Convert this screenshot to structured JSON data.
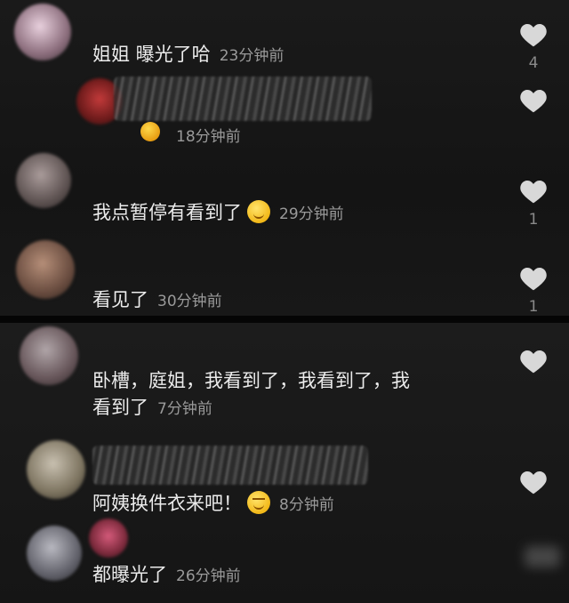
{
  "comments": [
    {
      "text": "姐姐 曝光了哈",
      "time": "23分钟前",
      "likes": "4"
    },
    {
      "reply_time": "18分钟前"
    },
    {
      "text": "我点暂停有看到了",
      "time": "29分钟前",
      "likes": "1"
    },
    {
      "text": "看见了",
      "time": "30分钟前",
      "likes": "1"
    },
    {
      "text_line1": "卧槽，庭姐，我看到了，我看到了，我",
      "text_line2": "看到了",
      "time": "7分钟前"
    },
    {
      "text": "阿姨换件衣来吧！",
      "time": "8分钟前"
    },
    {
      "text": "都曝光了",
      "time": "26分钟前"
    }
  ],
  "icons": {
    "like": "heart-icon",
    "emoji_smile": "smirk-face-emoji",
    "emoji_wink": "wink-face-emoji"
  },
  "colors": {
    "background": "#161616",
    "text": "#ececec",
    "meta": "#9a9a9a",
    "heart": "#d9d9d9"
  }
}
